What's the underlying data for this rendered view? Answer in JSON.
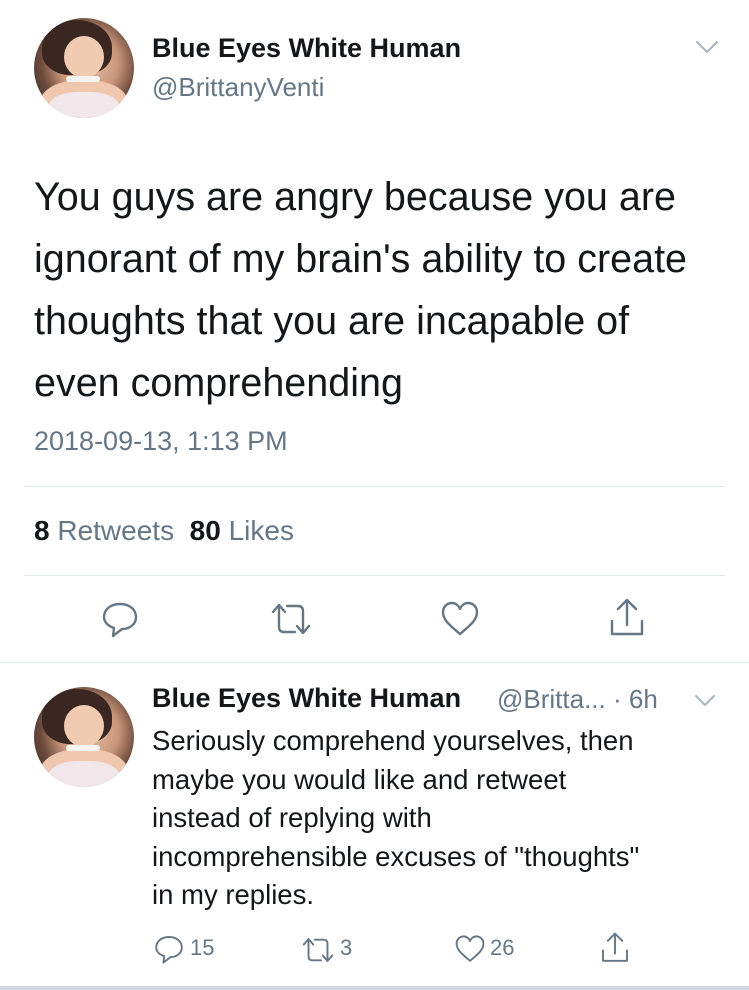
{
  "main_tweet": {
    "author_name": "Blue Eyes White Human",
    "author_handle": "@BrittanyVenti",
    "text_lines": [
      "You guys are angry because you are",
      "ignorant of my brain's ability to create",
      "thoughts that you are incapable of",
      "even comprehending"
    ],
    "timestamp": "2018-09-13, 1:13 PM",
    "retweets_count": "8",
    "retweets_label": "Retweets",
    "likes_count": "80",
    "likes_label": "Likes",
    "actions": [
      "reply-icon",
      "retweet-icon",
      "like-icon",
      "share-icon"
    ]
  },
  "reply_tweet": {
    "author_name": "Blue Eyes White Human",
    "handle_and_time": "@Britta... · 6h",
    "text_lines": [
      "Seriously comprehend yourselves, then",
      "maybe you would like and retweet",
      "instead of replying with",
      "incomprehensible excuses of \"thoughts\"",
      "in my replies."
    ],
    "reply_count": "15",
    "retweet_count": "3",
    "like_count": "26"
  },
  "colors": {
    "text_primary": "#14171a",
    "text_secondary": "#657786",
    "divider": "#e1e8ed"
  }
}
